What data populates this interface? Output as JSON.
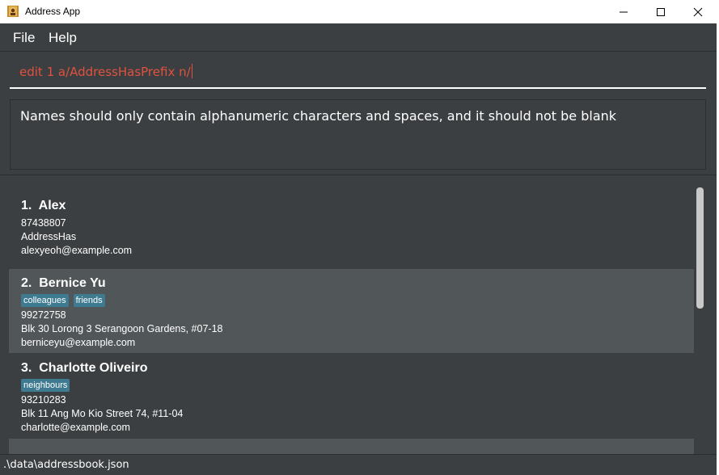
{
  "window": {
    "title": "Address App"
  },
  "menu": {
    "file": "File",
    "help": "Help"
  },
  "command": {
    "value": "edit 1 a/AddressHasPrefix n/"
  },
  "result": {
    "message": "Names should only contain alphanumeric characters and spaces, and it should not be blank"
  },
  "persons": [
    {
      "index": "1.",
      "name": "Alex",
      "tags": [],
      "phone": "87438807",
      "address": "AddressHas",
      "email": "alexyeoh@example.com"
    },
    {
      "index": "2.",
      "name": "Bernice Yu",
      "tags": [
        "colleagues",
        "friends"
      ],
      "phone": "99272758",
      "address": "Blk 30 Lorong 3 Serangoon Gardens, #07-18",
      "email": "berniceyu@example.com"
    },
    {
      "index": "3.",
      "name": "Charlotte Oliveiro",
      "tags": [
        "neighbours"
      ],
      "phone": "93210283",
      "address": "Blk 11 Ang Mo Kio Street 74, #11-04",
      "email": "charlotte@example.com"
    }
  ],
  "status": {
    "path": ".\\data\\addressbook.json"
  },
  "colors": {
    "background": "#3c3f41",
    "selected_card": "#515658",
    "tag": "#3e7b91",
    "command_text": "#e0523f"
  }
}
